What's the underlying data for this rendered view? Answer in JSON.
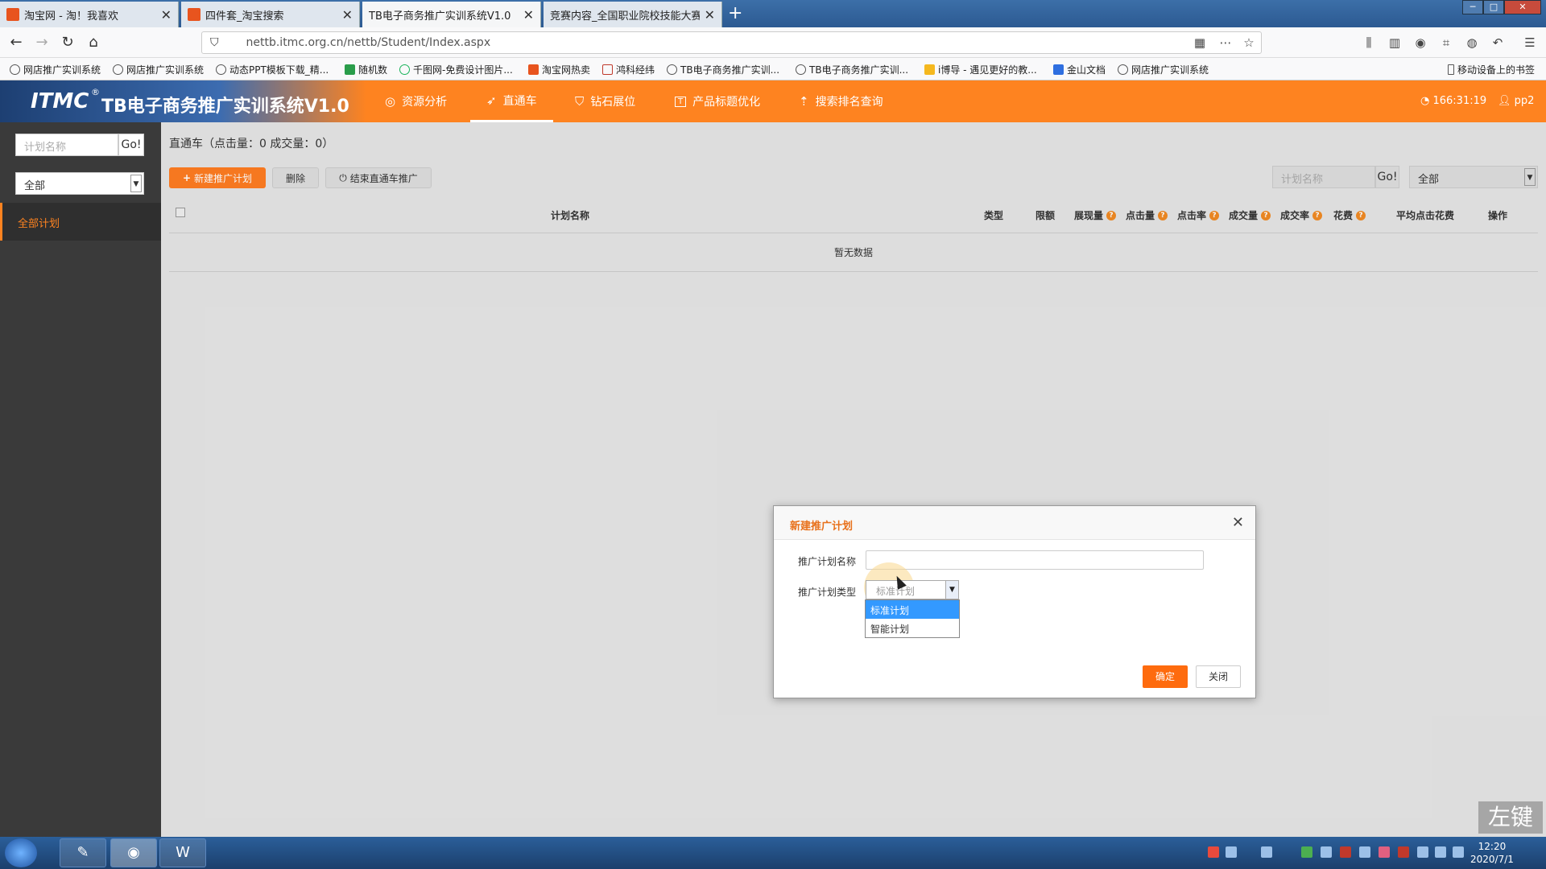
{
  "browser": {
    "tabs": [
      {
        "title": "淘宝网 - 淘！我喜欢",
        "icon_color": "#e8541e",
        "active": false
      },
      {
        "title": "四件套_淘宝搜索",
        "icon_color": "#e8541e",
        "active": false
      },
      {
        "title": "TB电子商务推广实训系统V1.0",
        "icon_color": "",
        "active": true
      },
      {
        "title": "竞赛内容_全国职业院校技能大赛中",
        "icon_color": "",
        "active": false
      }
    ],
    "new_tab": "+",
    "url": "nettb.itmc.org.cn/nettb/Student/Index.aspx",
    "bookmarks": [
      "网店推广实训系统",
      "网店推广实训系统",
      "动态PPT模板下载_精...",
      "随机数",
      "千图网-免费设计图片...",
      "淘宝网热卖",
      "鸿科经纬",
      "TB电子商务推广实训...",
      "TB电子商务推广实训...",
      "i博导 - 遇见更好的教...",
      "金山文档",
      "网店推广实训系统"
    ],
    "mobile_bookmarks": "移动设备上的书签"
  },
  "app": {
    "brand": "ITMC",
    "brand_reg": "®",
    "system_name": "TB电子商务推广实训系统V1.0",
    "menu": [
      {
        "label": "资源分析",
        "icon": "target-icon",
        "glyph": "◎"
      },
      {
        "label": "直通车",
        "icon": "rocket-icon",
        "glyph": "➶"
      },
      {
        "label": "钻石展位",
        "icon": "shield-icon",
        "glyph": "⛉"
      },
      {
        "label": "产品标题优化",
        "icon": "title-icon",
        "glyph": "T"
      },
      {
        "label": "搜索排名查询",
        "icon": "rank-icon",
        "glyph": "⇡"
      }
    ],
    "active_menu": "直通车",
    "timer": "166:31:19",
    "user": "pp2",
    "accent_color": "#fe8320"
  },
  "sidebar": {
    "search_placeholder": "计划名称",
    "go": "Go!",
    "filter_value": "全部",
    "all_plans": "全部计划"
  },
  "main": {
    "title": "直通车（点击量：0 成交量：0）",
    "btn_new": "新建推广计划",
    "btn_delete": "删除",
    "btn_end": "结束直通车推广",
    "search_placeholder": "计划名称",
    "go": "Go!",
    "filter_value": "全部",
    "columns": [
      "计划名称",
      "类型",
      "限额",
      "展现量",
      "点击量",
      "点击率",
      "成交量",
      "成交率",
      "花费",
      "平均点击花费",
      "操作"
    ],
    "empty_text": "暂无数据"
  },
  "modal": {
    "title": "新建推广计划",
    "name_label": "推广计划名称",
    "name_value": "",
    "type_label": "推广计划类型",
    "type_value": "标准计划",
    "type_options": [
      "标准计划",
      "智能计划"
    ],
    "ok": "确定",
    "close": "关闭"
  },
  "watermark": "左键",
  "taskbar": {
    "time": "12:20",
    "date": "2020/7/1"
  }
}
